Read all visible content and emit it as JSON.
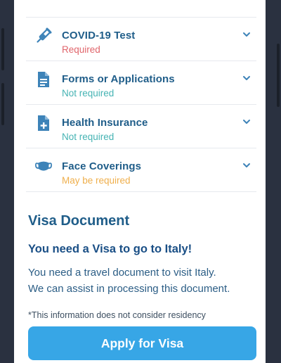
{
  "requirements": [
    {
      "title": "COVID-19 Test",
      "status": "Required",
      "status_color": "#e0656b",
      "icon": "test-tube-icon"
    },
    {
      "title": "Forms or Applications",
      "status": "Not required",
      "status_color": "#45b3b3",
      "icon": "document-icon"
    },
    {
      "title": "Health Insurance",
      "status": "Not required",
      "status_color": "#45b3b3",
      "icon": "medical-document-icon"
    },
    {
      "title": "Face Coverings",
      "status": "May be required",
      "status_color": "#efaf4c",
      "icon": "face-mask-icon"
    }
  ],
  "visa": {
    "section_title": "Visa Document",
    "subtitle": "You need a Visa to go to Italy!",
    "description_line1": "You need a travel document to visit Italy.",
    "description_line2": "We can assist in processing this document.",
    "disclaimer": "*This information does not consider residency",
    "apply_label": "Apply for Visa"
  },
  "colors": {
    "title": "#1f5d89",
    "icon": "#3d83b8",
    "accent_button": "#37a6e6",
    "chevron": "#3d83b8"
  }
}
